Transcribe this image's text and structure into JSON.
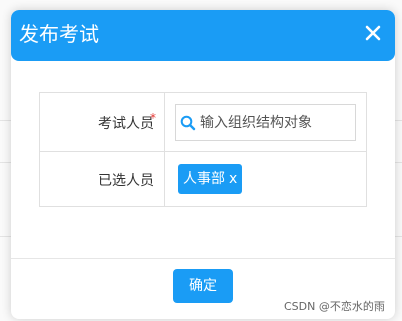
{
  "modal": {
    "title": "发布考试",
    "close_icon": "close-icon"
  },
  "form": {
    "examinee_label": "考试人员",
    "required_mark": "*",
    "search": {
      "icon": "search-icon",
      "placeholder": "输入组织结构对象",
      "value": ""
    },
    "selected_label": "已选人员",
    "selected_tags": [
      {
        "label": "人事部",
        "remove": "x"
      }
    ]
  },
  "footer": {
    "confirm_label": "确定"
  },
  "watermark": "CSDN @不恋水的雨",
  "colors": {
    "primary": "#1a9cf5",
    "required": "#e53935"
  }
}
